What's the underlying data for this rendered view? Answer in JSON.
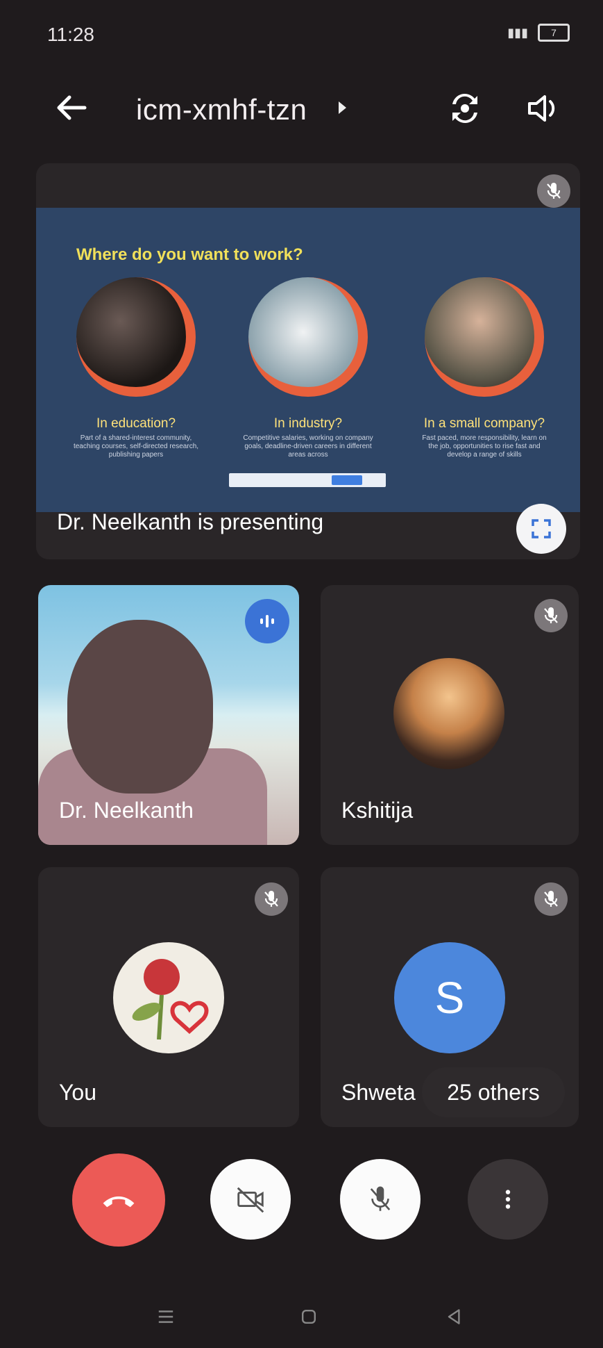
{
  "status_bar": {
    "time": "11:28",
    "battery": "7"
  },
  "header": {
    "meeting_code": "icm-xmhf-tzn"
  },
  "presentation": {
    "slide_heading": "Where do you want to work?",
    "columns": [
      {
        "title": "In education?",
        "text": "Part of a shared-interest community, teaching courses, self-directed research, publishing papers"
      },
      {
        "title": "In industry?",
        "text": "Competitive salaries, working on company goals, deadline-driven careers in different areas across"
      },
      {
        "title": "In a small company?",
        "text": "Fast paced, more responsibility, learn on the job, opportunities to rise fast and develop a range of skills"
      }
    ],
    "caption": "Dr. Neelkanth is presenting"
  },
  "participants": [
    {
      "name": "Dr. Neelkanth",
      "state": "speaking"
    },
    {
      "name": "Kshitija",
      "state": "muted"
    },
    {
      "name": "You",
      "state": "muted"
    },
    {
      "name": "Shweta",
      "initial": "S",
      "state": "muted"
    }
  ],
  "others_label": "25 others",
  "colors": {
    "end_call": "#ec5a56",
    "accent": "#3b73d6",
    "slide_bg": "#2e4566"
  }
}
